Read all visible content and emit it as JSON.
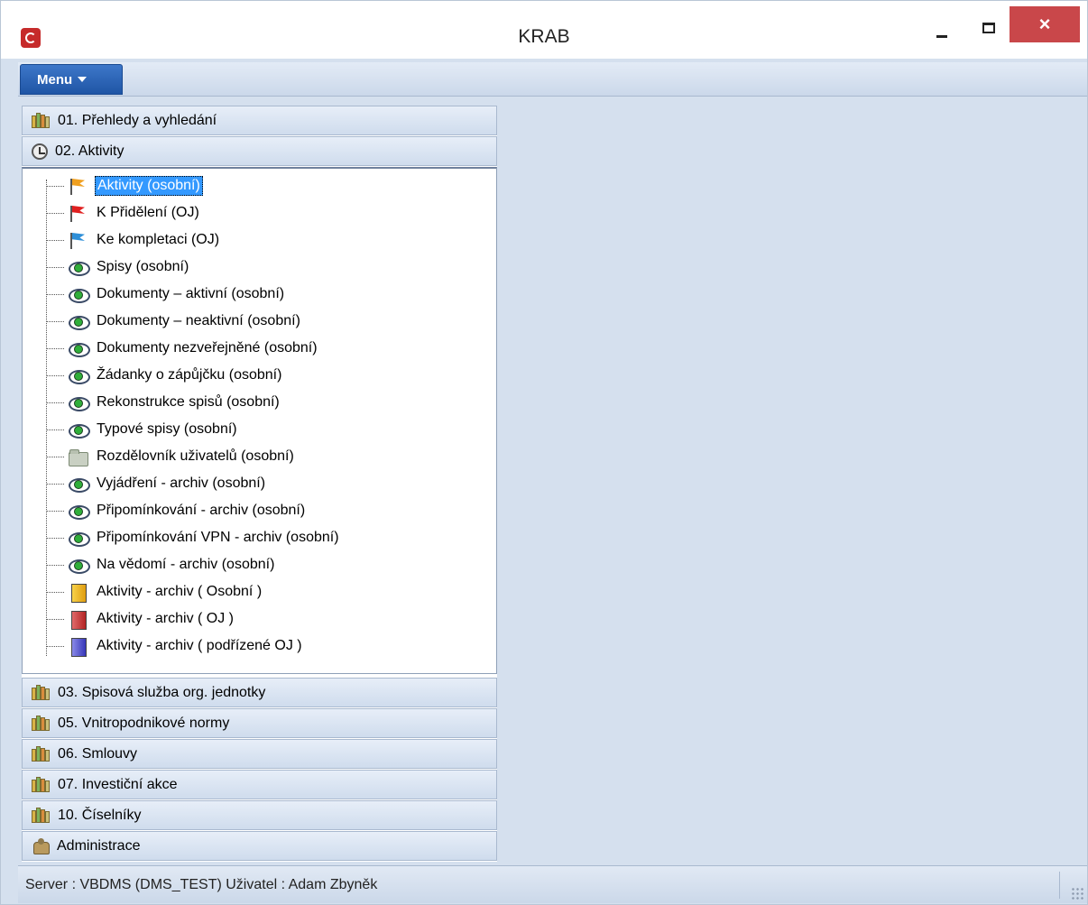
{
  "window": {
    "title": "KRAB",
    "close_glyph": "×"
  },
  "menubar": {
    "menu_label": "Menu"
  },
  "groups_top": [
    {
      "label": "01. Přehledy a vyhledání",
      "icon": "books-icon"
    },
    {
      "label": "02. Aktivity",
      "icon": "clock-icon"
    }
  ],
  "tree": {
    "items": [
      {
        "label": "Aktivity (osobní)",
        "icon": "flag-orange",
        "selected": true
      },
      {
        "label": "K Přidělení (OJ)",
        "icon": "flag-red"
      },
      {
        "label": "Ke kompletaci (OJ)",
        "icon": "flag-blue"
      },
      {
        "label": "Spisy (osobní)",
        "icon": "eye-icon"
      },
      {
        "label": "Dokumenty – aktivní (osobní)",
        "icon": "eye-icon"
      },
      {
        "label": "Dokumenty – neaktivní (osobní)",
        "icon": "eye-icon"
      },
      {
        "label": "Dokumenty nezveřejněné (osobní)",
        "icon": "eye-icon"
      },
      {
        "label": "Žádanky o zápůjčku (osobní)",
        "icon": "eye-icon"
      },
      {
        "label": "Rekonstrukce spisů (osobní)",
        "icon": "eye-icon"
      },
      {
        "label": "Typové spisy (osobní)",
        "icon": "eye-icon"
      },
      {
        "label": "Rozdělovník uživatelů (osobní)",
        "icon": "folder-icon"
      },
      {
        "label": "Vyjádření - archiv (osobní)",
        "icon": "eye-icon"
      },
      {
        "label": "Připomínkování - archiv (osobní)",
        "icon": "eye-icon"
      },
      {
        "label": "Připomínkování VPN - archiv (osobní)",
        "icon": "eye-icon"
      },
      {
        "label": "Na vědomí - archiv (osobní)",
        "icon": "eye-icon"
      },
      {
        "label": "Aktivity - archiv ( Osobní )",
        "icon": "box-yellow"
      },
      {
        "label": "Aktivity - archiv ( OJ )",
        "icon": "box-red"
      },
      {
        "label": "Aktivity - archiv ( podřízené OJ )",
        "icon": "box-blue"
      }
    ]
  },
  "groups_bottom": [
    {
      "label": "03. Spisová služba org. jednotky",
      "icon": "books-icon"
    },
    {
      "label": "05. Vnitropodnikové normy",
      "icon": "books-icon"
    },
    {
      "label": "06. Smlouvy",
      "icon": "books-icon"
    },
    {
      "label": "07. Investiční akce",
      "icon": "books-icon"
    },
    {
      "label": "10. Číselníky",
      "icon": "books-icon"
    },
    {
      "label": "Administrace",
      "icon": "gear-icon"
    }
  ],
  "status": {
    "text": "Server : VBDMS (DMS_TEST) Uživatel : Adam Zbyněk"
  }
}
